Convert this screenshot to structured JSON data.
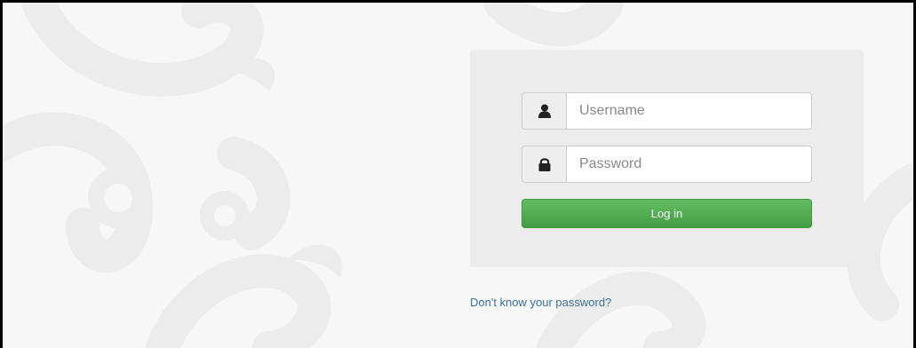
{
  "login": {
    "username": {
      "placeholder": "Username",
      "value": "",
      "icon": "user-icon"
    },
    "password": {
      "placeholder": "Password",
      "value": "",
      "icon": "lock-icon"
    },
    "submit_label": "Log in",
    "forgot_link": "Don't know your password?"
  },
  "colors": {
    "accent_green": "#5cb85c",
    "link_blue": "#3a6f9a",
    "panel_bg": "#ececec"
  }
}
